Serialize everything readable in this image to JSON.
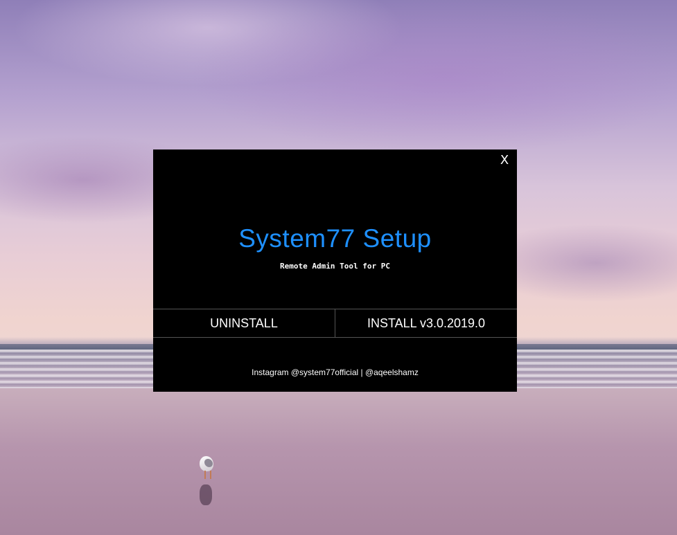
{
  "dialog": {
    "close_label": "X",
    "title": "System77 Setup",
    "subtitle": "Remote Admin Tool for PC",
    "uninstall_label": "UNINSTALL",
    "install_label": "INSTALL v3.0.2019.0",
    "footer": "Instagram @system77official | @aqeelshamz",
    "title_color": "#1e90ff",
    "background_color": "#000000"
  },
  "wallpaper": {
    "subject": "beach at sunset with seagull",
    "seagull_icon": "seagull-icon"
  }
}
